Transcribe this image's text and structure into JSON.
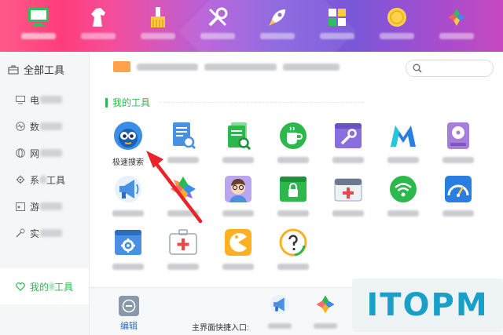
{
  "topnav": {
    "items": [
      {
        "icon": "monitor-icon",
        "color": "#2dc05a",
        "active": true
      },
      {
        "icon": "horse-icon",
        "color": "#ffffff"
      },
      {
        "icon": "brush-icon",
        "color": "#ffc940"
      },
      {
        "icon": "wrench-icon",
        "color": "#ffffff"
      },
      {
        "icon": "rocket-icon",
        "color": "#ffffff"
      },
      {
        "icon": "grid-icon",
        "color": "#ffffff"
      },
      {
        "icon": "coin-icon",
        "color": "#ffd24a"
      },
      {
        "icon": "apps-icon",
        "color": "#ffffff"
      }
    ]
  },
  "sidebar": {
    "header": "全部工具",
    "items": [
      {
        "prefix": "电",
        "icon": "monitor-icon"
      },
      {
        "prefix": "数",
        "icon": "heartbeat-icon"
      },
      {
        "prefix": "网",
        "icon": "globe-icon"
      },
      {
        "prefix": "系",
        "suffix": "工具",
        "icon": "gear-icon"
      },
      {
        "prefix": "游",
        "icon": "gamepad-icon"
      },
      {
        "prefix": "实",
        "icon": "wrench-icon"
      }
    ],
    "active": {
      "prefix": "我的",
      "suffix": "工具",
      "icon": "heart-icon"
    }
  },
  "section_title": "我的工具",
  "tools": [
    {
      "label": "极速搜索",
      "icon": "eyes-search-icon",
      "color": "#3a8ee6"
    },
    {
      "label": "",
      "icon": "doc-search-icon",
      "color": "#4a90e2"
    },
    {
      "label": "",
      "icon": "green-doc-icon",
      "color": "#2db84d"
    },
    {
      "label": "",
      "icon": "cup-icon",
      "color": "#2db84d"
    },
    {
      "label": "",
      "icon": "wrench-window-icon",
      "color": "#8a6fdc"
    },
    {
      "label": "",
      "icon": "m-logo-icon",
      "color": "#2a7de1"
    },
    {
      "label": "",
      "icon": "disk-icon",
      "color": "#a77ed9"
    },
    {
      "label": "",
      "icon": "megaphone-icon",
      "color": "#4a90e2"
    },
    {
      "label": "",
      "icon": "flower-icon",
      "color": "#ff9a3c"
    },
    {
      "label": "",
      "icon": "person-icon",
      "color": "#8a6fdc"
    },
    {
      "label": "",
      "icon": "lock-window-icon",
      "color": "#2db84d"
    },
    {
      "label": "",
      "icon": "medkit-window-icon",
      "color": "#4a90e2"
    },
    {
      "label": "",
      "icon": "wifi-icon",
      "color": "#2db84d"
    },
    {
      "label": "",
      "icon": "speedometer-icon",
      "color": "#2a7de1"
    },
    {
      "label": "",
      "icon": "gear-window-icon",
      "color": "#4a90e2"
    },
    {
      "label": "",
      "icon": "medkit-icon",
      "color": "#e84a4a"
    },
    {
      "label": "",
      "icon": "pacman-icon",
      "color": "#ffb020"
    },
    {
      "label": "",
      "icon": "question-icon",
      "color": "#ffb020"
    }
  ],
  "bottom": {
    "edit_label": "编辑",
    "shortcut_prefix": "主界面快捷入口:",
    "minis": [
      {
        "icon": "megaphone-icon"
      },
      {
        "icon": "flower-icon"
      }
    ]
  },
  "watermark": "ITOPM",
  "colors": {
    "accent": "#2db84d",
    "arrow": "#e8232a"
  }
}
